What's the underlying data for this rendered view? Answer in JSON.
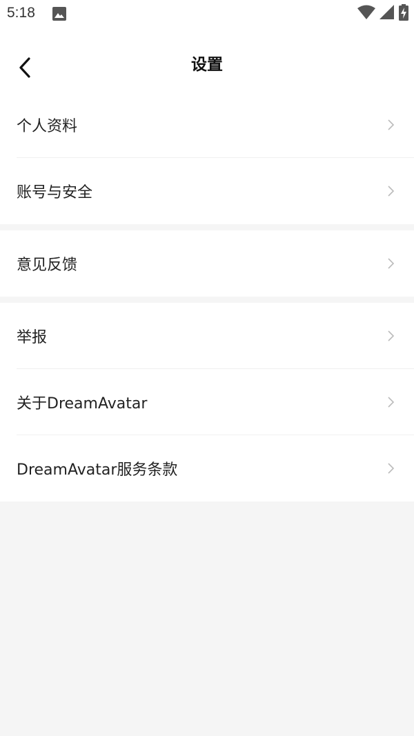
{
  "status_bar": {
    "time": "5:18",
    "icons": [
      "photo-icon",
      "wifi-icon",
      "signal-icon",
      "battery-charging-icon"
    ]
  },
  "header": {
    "title": "设置",
    "back_icon": "chevron-left-icon"
  },
  "groups": [
    {
      "items": [
        {
          "label": "个人资料"
        },
        {
          "label": "账号与安全"
        }
      ]
    },
    {
      "items": [
        {
          "label": "意见反馈"
        }
      ]
    },
    {
      "items": [
        {
          "label": "举报"
        },
        {
          "label": "关于DreamAvatar"
        },
        {
          "label": "DreamAvatar服务条款"
        }
      ]
    }
  ],
  "colors": {
    "background": "#f5f5f5",
    "surface": "#ffffff",
    "text": "#222222",
    "chevron": "#bbbbbb",
    "divider": "#f0f0f0"
  }
}
